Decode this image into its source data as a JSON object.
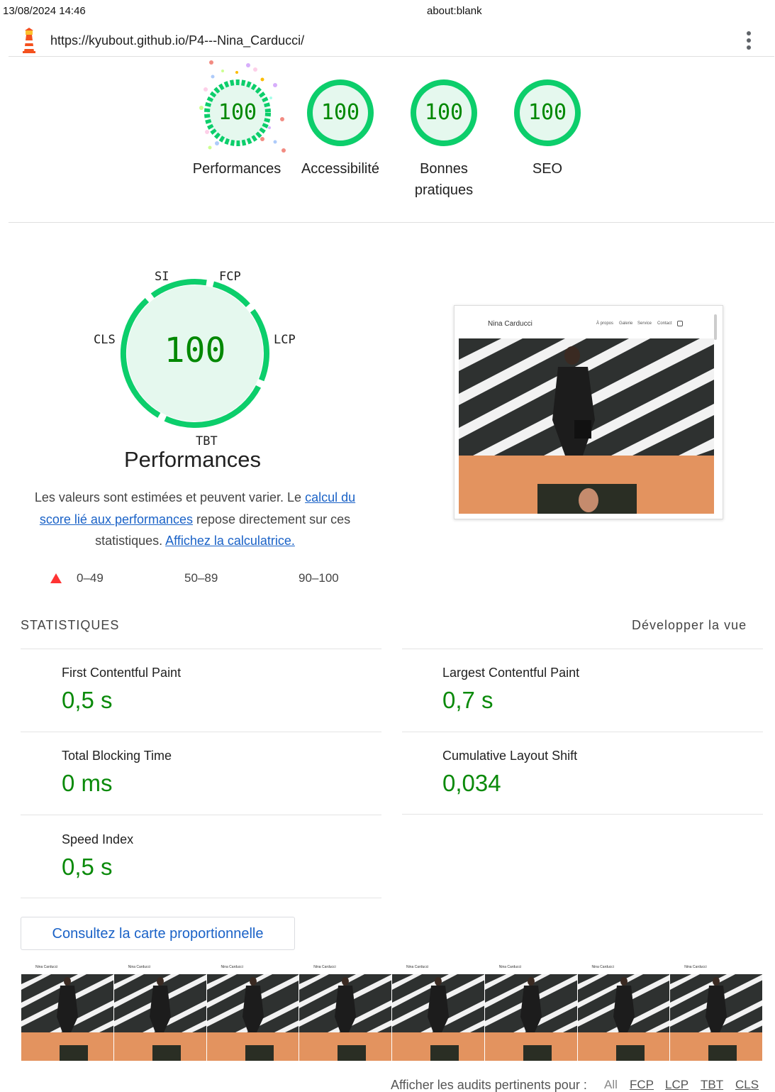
{
  "print": {
    "datetime": "13/08/2024 14:46",
    "page_title": "about:blank"
  },
  "topbar": {
    "url": "https://kyubout.github.io/P4---Nina_Carducci/",
    "logo_icon": "lighthouse-icon",
    "menu_icon": "more-vert-icon"
  },
  "categories": [
    {
      "score": "100",
      "label": "Performances"
    },
    {
      "score": "100",
      "label": "Accessibilité"
    },
    {
      "score": "100",
      "label": "Bonnes pratiques"
    },
    {
      "score": "100",
      "label": "SEO"
    }
  ],
  "performance": {
    "score": "100",
    "title": "Performances",
    "metric_tags": {
      "si": "SI",
      "fcp": "FCP",
      "lcp": "LCP",
      "tbt": "TBT",
      "cls": "CLS"
    },
    "description": {
      "text1": "Les valeurs sont estimées et peuvent varier. Le ",
      "link1": "calcul du score lié aux performances",
      "text2": " repose directement sur ces statistiques. ",
      "link2": "Affichez la calculatrice."
    },
    "legend": {
      "fail": "0–49",
      "average": "50–89",
      "pass": "90–100"
    }
  },
  "screenshot": {
    "site_name": "Nina Carducci",
    "nav": [
      "À propos",
      "Galerie",
      "Service",
      "Contact"
    ]
  },
  "stats": {
    "heading": "STATISTIQUES",
    "expand": "Développer la vue",
    "metrics": [
      {
        "name": "First Contentful Paint",
        "value": "0,5 s"
      },
      {
        "name": "Largest Contentful Paint",
        "value": "0,7 s"
      },
      {
        "name": "Total Blocking Time",
        "value": "0 ms"
      },
      {
        "name": "Cumulative Layout Shift",
        "value": "0,034"
      },
      {
        "name": "Speed Index",
        "value": "0,5 s"
      }
    ]
  },
  "treemap_button": "Consultez la carte proportionnelle",
  "filmstrip": {
    "site_name": "Nina Carducci"
  },
  "audits_filter": {
    "label": "Afficher les audits pertinents pour :",
    "options": [
      "All",
      "FCP",
      "LCP",
      "TBT",
      "CLS"
    ]
  },
  "colors": {
    "pass": "#0cce6b",
    "pass_text": "#008800",
    "pass_fill": "#e5f8ee",
    "fail": "#ff3333",
    "link": "#1a62c7",
    "hero_bg": "#e3935f"
  }
}
